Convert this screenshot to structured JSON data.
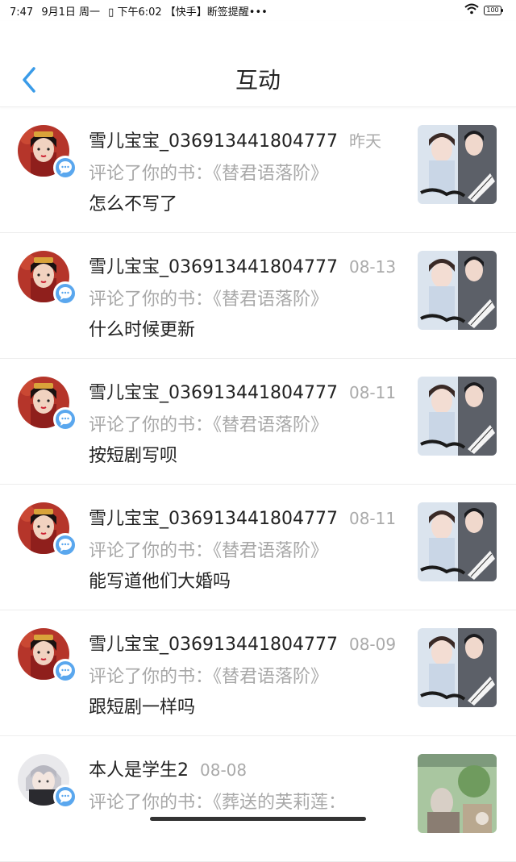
{
  "status": {
    "time": "7:47",
    "date": "9月1日 周一",
    "notification": "下午6:02 【快手】断签提醒•••",
    "battery": "100"
  },
  "header": {
    "title": "互动"
  },
  "items": [
    {
      "name": "雪儿宝宝_036913441804777",
      "date": "昨天",
      "action": "评论了你的书：《替君语落阶》",
      "comment": "怎么不写了",
      "avatar": "girl",
      "cover": "drama"
    },
    {
      "name": "雪儿宝宝_036913441804777",
      "date": "08-13",
      "action": "评论了你的书：《替君语落阶》",
      "comment": "什么时候更新",
      "avatar": "girl",
      "cover": "drama"
    },
    {
      "name": "雪儿宝宝_036913441804777",
      "date": "08-11",
      "action": "评论了你的书：《替君语落阶》",
      "comment": "按短剧写呗",
      "avatar": "girl",
      "cover": "drama"
    },
    {
      "name": "雪儿宝宝_036913441804777",
      "date": "08-11",
      "action": "评论了你的书：《替君语落阶》",
      "comment": "能写道他们大婚吗",
      "avatar": "girl",
      "cover": "drama"
    },
    {
      "name": "雪儿宝宝_036913441804777",
      "date": "08-09",
      "action": "评论了你的书：《替君语落阶》",
      "comment": "跟短剧一样吗",
      "avatar": "girl",
      "cover": "drama"
    },
    {
      "name": "本人是学生2",
      "date": "08-08",
      "action": "评论了你的书：《葬送的芙莉莲：",
      "comment": "",
      "avatar": "anime",
      "cover": "anime"
    }
  ],
  "colors": {
    "accent": "#5aa7ee",
    "back": "#3a9be8",
    "muted": "#a8a8a8"
  }
}
